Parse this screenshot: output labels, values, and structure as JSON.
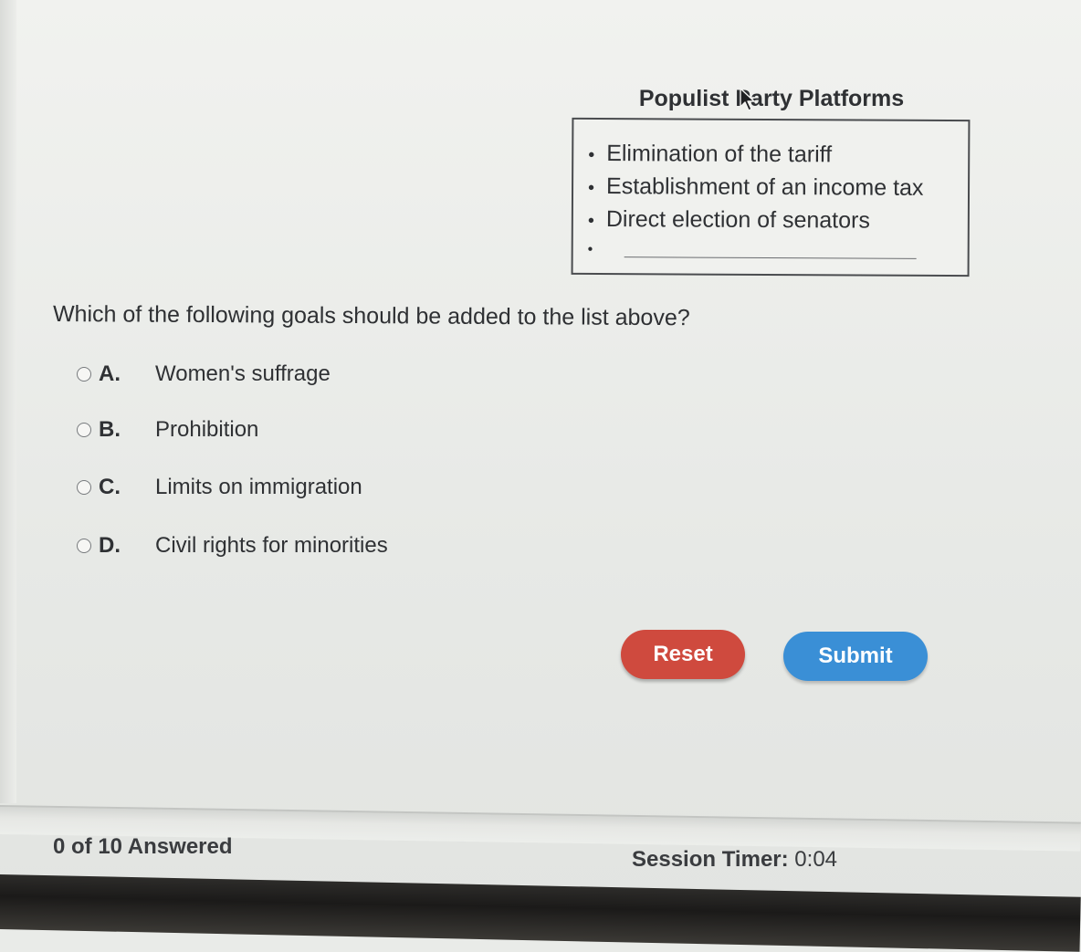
{
  "platform": {
    "title": "Populist Party Platforms",
    "items": [
      "Elimination of the tariff",
      "Establishment of an income tax",
      "Direct election of senators"
    ],
    "bullet": "•"
  },
  "question": {
    "text": "Which of the following goals should be added to the list above?",
    "options": [
      {
        "letter": "A.",
        "text": "Women's suffrage"
      },
      {
        "letter": "B.",
        "text": "Prohibition"
      },
      {
        "letter": "C.",
        "text": "Limits on immigration"
      },
      {
        "letter": "D.",
        "text": "Civil rights for minorities"
      }
    ]
  },
  "buttons": {
    "reset_label": "Reset",
    "submit_label": "Submit"
  },
  "footer": {
    "answered": "0 of 10 Answered",
    "timer_label": "Session Timer:",
    "timer_value": "0:04"
  },
  "colors": {
    "reset": "#cf4a3e",
    "submit": "#3a8fd6"
  },
  "icons": {
    "cursor": "mouse-pointer-icon"
  }
}
